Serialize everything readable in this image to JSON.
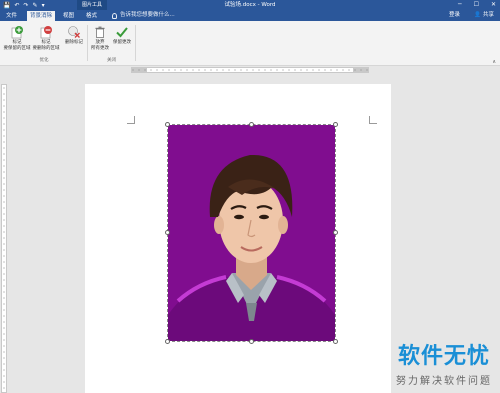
{
  "titlebar": {
    "context_tab": "图片工具",
    "doc_title": "试验场.docx - Word",
    "window_buttons": [
      "─",
      "☐",
      "✕"
    ]
  },
  "tabs": [
    {
      "label": "文件",
      "active": false
    },
    {
      "label": "背景消除",
      "active": true
    },
    {
      "label": "视图",
      "active": false
    },
    {
      "label": "格式",
      "active": false
    }
  ],
  "tell_me": "告诉我您想要做什么...",
  "login": "登录",
  "share": "共享",
  "ribbon": {
    "buttons": [
      {
        "label_line1": "标记",
        "label_line2": "要保留的区域",
        "icon": "plus-circle-icon",
        "color": "#3a9b3a"
      },
      {
        "label_line1": "标记",
        "label_line2": "要删除的区域",
        "icon": "minus-circle-icon",
        "color": "#d13f3f"
      },
      {
        "label_line1": "删除标记",
        "label_line2": "",
        "icon": "delete-mark-icon",
        "color": "#d13f3f"
      },
      {
        "label_line1": "放弃",
        "label_line2": "所有更改",
        "icon": "discard-icon",
        "color": "#777777"
      },
      {
        "label_line1": "保留更改",
        "label_line2": "",
        "icon": "checkmark-icon",
        "color": "#3a9b3a"
      }
    ],
    "groups": [
      "优化",
      "关闭"
    ]
  },
  "photo": {
    "background_color": "#800d8f",
    "description_icon": "portrait-photo"
  },
  "watermark": {
    "main": "软件无忧",
    "sub": "努力解决软件问题"
  }
}
